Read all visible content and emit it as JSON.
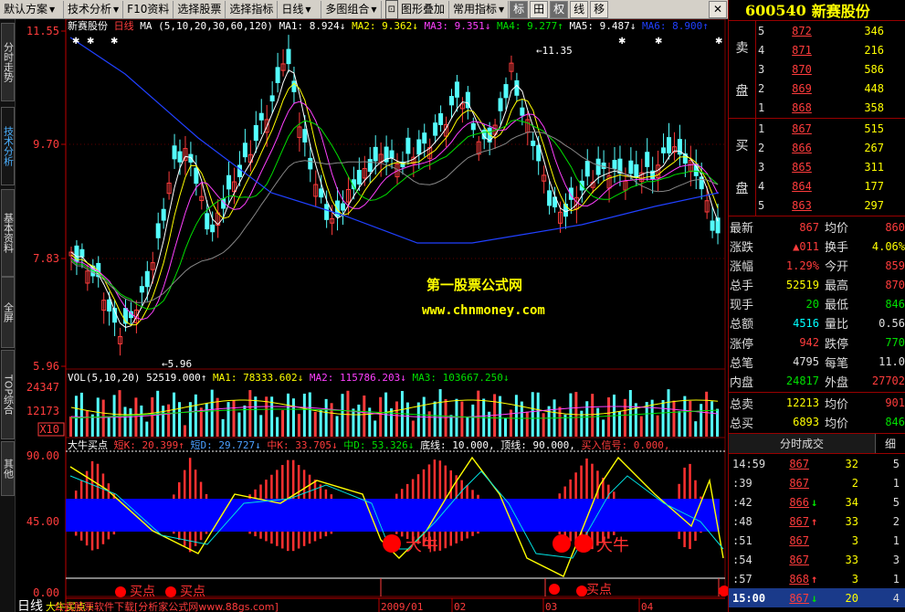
{
  "toolbar": {
    "items": [
      "默认方案",
      "技术分析",
      "F10资料",
      "选择股票",
      "选择指标",
      "日线",
      "多图组合",
      "图形叠加",
      "常用指标"
    ],
    "toggles": [
      "标",
      "田",
      "权",
      "线",
      "移"
    ]
  },
  "side_tabs": [
    "分时走势",
    "技术分析",
    "基本资料",
    "全屏",
    "TOP综合",
    "其他"
  ],
  "main_chart": {
    "stock_name": "新赛股份",
    "period": "日线",
    "ma_params": "MA (5,10,20,30,60,120)",
    "ma_labels": [
      "MA1: 8.924↓",
      "MA2: 9.362↓",
      "MA3: 9.351↓",
      "MA4: 9.277↑",
      "MA5: 9.487↓",
      "MA6: 8.900↑"
    ],
    "high_label": "11.35",
    "low_label": "5.96",
    "y_labels": [
      "11.55",
      "9.70",
      "7.83",
      "5.96"
    ]
  },
  "watermark": {
    "title": "第一股票公式网",
    "url": "www.chnmoney.com"
  },
  "volume": {
    "header": "VOL(5,10,20)",
    "labels": [
      "52519.000↑",
      "MA1: 78333.602↓",
      "MA2: 115786.203↓",
      "MA3: 103667.250↓"
    ],
    "y_labels": [
      "24347",
      "12173",
      "X10"
    ]
  },
  "indicator": {
    "title": "大牛买点",
    "labels": [
      "短K: 20.399↑",
      "短D: 29.727↓",
      "中K: 33.705↓",
      "中D: 53.326↓",
      "底线: 10.000,",
      "顶线: 90.000,",
      "买入信号: 0.000,"
    ],
    "y_labels": [
      "90.00",
      "45.00",
      "0.00"
    ],
    "big_bull": "大牛",
    "buy_point": "买点"
  },
  "timeline": {
    "period": "日线",
    "link": "大牛买点+",
    "footer": "公式股票软件下载[分析家公式网www.88gs.com]",
    "dates": [
      "2009/01",
      "02",
      "03",
      "04"
    ]
  },
  "quote": {
    "code": "600540",
    "name": "新赛股份",
    "sell_label": [
      "卖",
      "盘"
    ],
    "buy_label": [
      "买",
      "盘"
    ],
    "asks": [
      {
        "level": "5",
        "price": "872",
        "vol": "346"
      },
      {
        "level": "4",
        "price": "871",
        "vol": "216"
      },
      {
        "level": "3",
        "price": "870",
        "vol": "586"
      },
      {
        "level": "2",
        "price": "869",
        "vol": "448"
      },
      {
        "level": "1",
        "price": "868",
        "vol": "358"
      }
    ],
    "bids": [
      {
        "level": "1",
        "price": "867",
        "vol": "515"
      },
      {
        "level": "2",
        "price": "866",
        "vol": "267"
      },
      {
        "level": "3",
        "price": "865",
        "vol": "311"
      },
      {
        "level": "4",
        "price": "864",
        "vol": "177"
      },
      {
        "level": "5",
        "price": "863",
        "vol": "297"
      }
    ],
    "stats": [
      {
        "k": "最新",
        "v": "867",
        "vc": "red",
        "k2": "均价",
        "v2": "860",
        "v2c": "red"
      },
      {
        "k": "涨跌",
        "v": "▲011",
        "vc": "red",
        "k2": "换手",
        "v2": "4.06%",
        "v2c": "yel"
      },
      {
        "k": "涨幅",
        "v": "1.29%",
        "vc": "red",
        "k2": "今开",
        "v2": "859",
        "v2c": "red"
      },
      {
        "k": "总手",
        "v": "52519",
        "vc": "yel",
        "k2": "最高",
        "v2": "870",
        "v2c": "red"
      },
      {
        "k": "现手",
        "v": "20",
        "vc": "grn",
        "k2": "最低",
        "v2": "846",
        "v2c": "grn"
      },
      {
        "k": "总额",
        "v": "4516",
        "vc": "cyan",
        "k2": "量比",
        "v2": "0.56",
        "v2c": "wht"
      },
      {
        "k": "涨停",
        "v": "942",
        "vc": "red",
        "k2": "跌停",
        "v2": "770",
        "v2c": "grn"
      },
      {
        "k": "总笔",
        "v": "4795",
        "vc": "wht",
        "k2": "每笔",
        "v2": "11.0",
        "v2c": "wht"
      },
      {
        "k": "内盘",
        "v": "24817",
        "vc": "grn",
        "k2": "外盘",
        "v2": "27702",
        "v2c": "red"
      }
    ],
    "summary": [
      {
        "k": "总卖",
        "v": "12213",
        "vc": "yel",
        "k2": "均价",
        "v2": "901",
        "v2c": "red"
      },
      {
        "k": "总买",
        "v": "6893",
        "vc": "yel",
        "k2": "均价",
        "v2": "846",
        "v2c": "grn"
      }
    ],
    "ticks_tab": "分时成交",
    "ticks_tab2": "细",
    "ticks": [
      {
        "t": "14:59",
        "p": "867",
        "a": "",
        "v": "32",
        "n": "5"
      },
      {
        "t": ":39",
        "p": "867",
        "a": "",
        "v": "2",
        "n": "1"
      },
      {
        "t": ":42",
        "p": "866",
        "a": "↓",
        "v": "34",
        "n": "5"
      },
      {
        "t": ":48",
        "p": "867",
        "a": "↑",
        "v": "33",
        "n": "2"
      },
      {
        "t": ":51",
        "p": "867",
        "a": "",
        "v": "3",
        "n": "1"
      },
      {
        "t": ":54",
        "p": "867",
        "a": "",
        "v": "33",
        "n": "3"
      },
      {
        "t": ":57",
        "p": "868",
        "a": "↑",
        "v": "3",
        "n": "1"
      },
      {
        "t": "15:00",
        "p": "867",
        "a": "↓",
        "v": "20",
        "n": "4"
      }
    ]
  },
  "colors": {
    "up": "#ff3c3c",
    "down": "#54ffff",
    "ma1": "#ffffff",
    "ma2": "#ffff00",
    "ma3": "#ff40ff",
    "ma4": "#00e000",
    "ma5": "#888888",
    "ma6": "#2040ff",
    "blueband": "#0000ff"
  }
}
